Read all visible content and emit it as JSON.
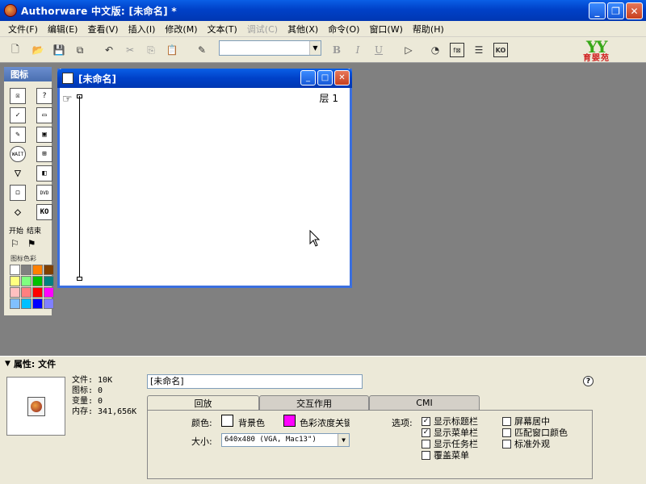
{
  "window": {
    "title": "Authorware 中文版: [未命名] *"
  },
  "menubar": {
    "items": [
      {
        "label": "文件(F)"
      },
      {
        "label": "编辑(E)"
      },
      {
        "label": "查看(V)"
      },
      {
        "label": "插入(I)"
      },
      {
        "label": "修改(M)"
      },
      {
        "label": "文本(T)"
      },
      {
        "label": "调试(C)",
        "disabled": true
      },
      {
        "label": "其他(X)"
      },
      {
        "label": "命令(O)"
      },
      {
        "label": "窗口(W)"
      },
      {
        "label": "帮助(H)"
      }
    ]
  },
  "logo": {
    "mark": "YY",
    "text": "育婴苑"
  },
  "iconpanel": {
    "title": "图标",
    "start_label": "开始",
    "end_label": "结束",
    "color_label": "图标色彩",
    "icons": [
      {
        "name": "display-icon",
        "glyph": "☒"
      },
      {
        "name": "decision-icon",
        "glyph": "?"
      },
      {
        "name": "motion-icon",
        "glyph": "✓"
      },
      {
        "name": "interaction-icon",
        "glyph": "▭"
      },
      {
        "name": "erase-icon",
        "glyph": "✎"
      },
      {
        "name": "calculation-icon",
        "glyph": "▣"
      },
      {
        "name": "wait-icon",
        "glyph": "WAIT"
      },
      {
        "name": "framework-icon",
        "glyph": "⊞"
      },
      {
        "name": "navigate-icon",
        "glyph": "▽"
      },
      {
        "name": "digital-movie-icon",
        "glyph": "◧"
      },
      {
        "name": "map-icon",
        "glyph": "◻"
      },
      {
        "name": "sound-icon",
        "glyph": "DVD"
      },
      {
        "name": "group-icon",
        "glyph": "◇"
      },
      {
        "name": "knowledge-object-icon",
        "glyph": "KO"
      }
    ],
    "swatches": [
      "#ffffff",
      "#808080",
      "#ff8000",
      "#804000",
      "#ffff80",
      "#80ff80",
      "#00c000",
      "#008080",
      "#ffc0c0",
      "#ff8080",
      "#ff0000",
      "#ff00ff",
      "#80c0ff",
      "#00c0ff",
      "#0000ff",
      "#8080ff"
    ]
  },
  "flowchart": {
    "title": "[未命名]",
    "layer": "层 1"
  },
  "properties": {
    "header": "属性: 文件",
    "file_info": [
      "文件: 10K",
      "图标: 0",
      "变量: 0",
      "内存: 341,656K"
    ],
    "file_name": "[未命名]",
    "help": "?",
    "tabs": [
      {
        "label": "回放",
        "active": true
      },
      {
        "label": "交互作用"
      },
      {
        "label": "CMI"
      }
    ],
    "color_label": "颜色:",
    "background_label": "背景色",
    "background_color": "#ffffff",
    "chroma_label": "色彩浓度关键",
    "chroma_color": "#ff00ff",
    "size_label": "大小:",
    "size_value": "640x480 (VGA, Mac13\")",
    "options_label": "选项:",
    "options_left": [
      {
        "label": "显示标题栏",
        "checked": true
      },
      {
        "label": "显示菜单栏",
        "checked": true
      },
      {
        "label": "显示任务栏",
        "checked": false
      },
      {
        "label": "覆盖菜单",
        "checked": false
      }
    ],
    "options_right": [
      {
        "label": "屏幕居中",
        "checked": false
      },
      {
        "label": "匹配窗口颜色",
        "checked": false
      },
      {
        "label": "标准外观",
        "checked": false
      }
    ]
  }
}
